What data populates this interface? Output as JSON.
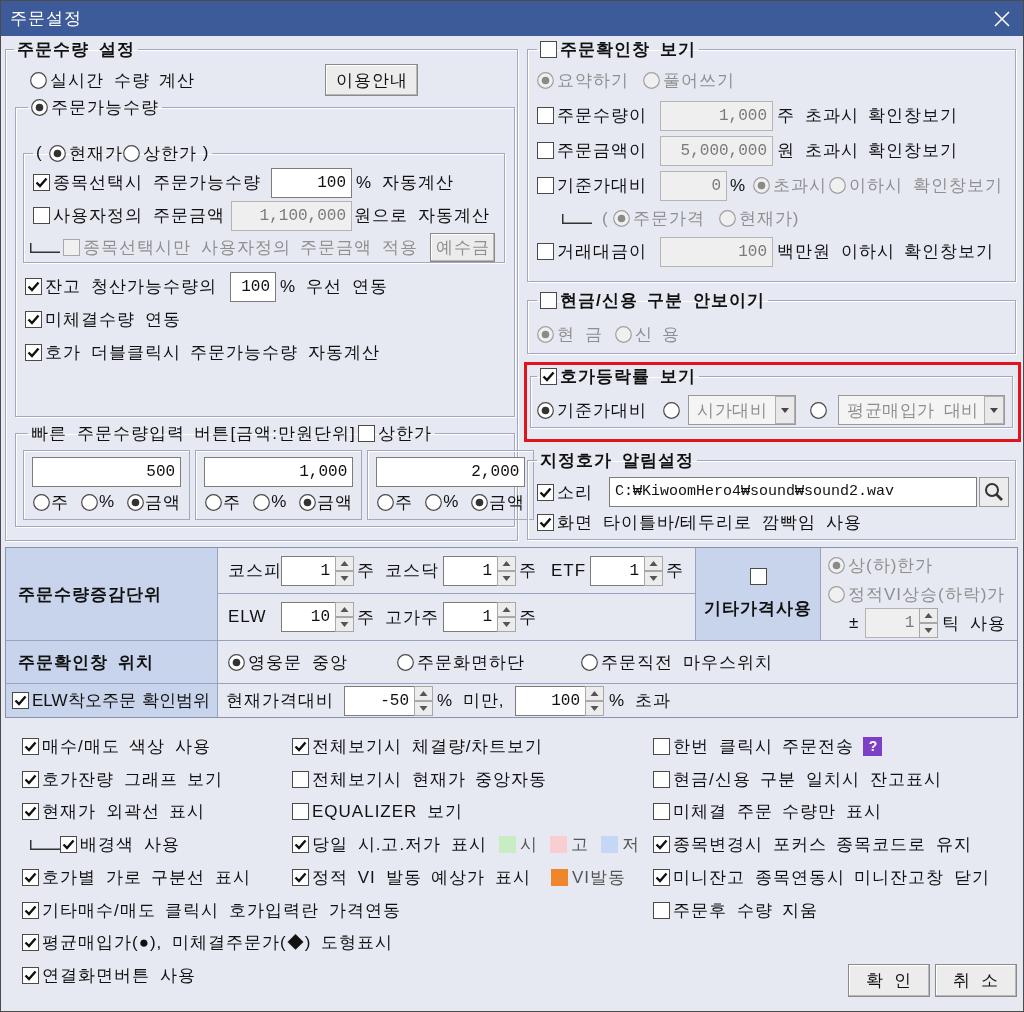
{
  "window": {
    "title": "주문설정"
  },
  "order_qty": {
    "legend": [
      {
        "kind": "text",
        "text": "주문수량 설정"
      }
    ],
    "items": [
      {
        "kind": "row",
        "parts": [
          {
            "kind": "radio",
            "label": "실시간 수량 계산",
            "selected": false
          },
          {
            "kind": "button",
            "label": "이용안내"
          }
        ]
      },
      {
        "kind": "group",
        "legend": [
          {
            "kind": "radio",
            "label": "주문가능수량",
            "selected": true
          }
        ],
        "items": [
          {
            "kind": "group",
            "legend": [
              {
                "kind": "text",
                "text": "("
              },
              {
                "kind": "radio",
                "label": "현재가",
                "selected": true
              },
              {
                "kind": "radio",
                "label": "상한가",
                "selected": false
              },
              {
                "kind": "text",
                "text": ")"
              }
            ],
            "items": [
              {
                "kind": "row",
                "parts": [
                  {
                    "kind": "check",
                    "label": "종목선택시 주문가능수량",
                    "checked": true
                  },
                  {
                    "kind": "input",
                    "value": "100"
                  },
                  {
                    "kind": "text",
                    "text": "% 자동계산"
                  }
                ]
              },
              {
                "kind": "row",
                "parts": [
                  {
                    "kind": "check",
                    "label": "사용자정의 주문금액",
                    "checked": false,
                    "disabled": false
                  },
                  {
                    "kind": "input",
                    "value": "1,100,000",
                    "disabled": true
                  },
                  {
                    "kind": "text",
                    "text": "원으로 자동계산",
                    "disabled": false
                  }
                ]
              },
              {
                "kind": "row",
                "parts": [
                  {
                    "kind": "branch"
                  },
                  {
                    "kind": "check",
                    "label": "종목선택시만 사용자정의 주문금액 적용",
                    "checked": false,
                    "disabled": true
                  },
                  {
                    "kind": "button",
                    "label": "예수금",
                    "disabled": true
                  }
                ]
              }
            ]
          },
          {
            "kind": "row",
            "parts": [
              {
                "kind": "check",
                "label": "잔고 청산가능수량의",
                "checked": true
              },
              {
                "kind": "input",
                "value": "100"
              },
              {
                "kind": "text",
                "text": "% 우선 연동"
              }
            ]
          },
          {
            "kind": "row",
            "parts": [
              {
                "kind": "check",
                "label": "미체결수량 연동",
                "checked": true
              }
            ]
          },
          {
            "kind": "row",
            "parts": [
              {
                "kind": "check",
                "label": "호가 더블클릭시 주문가능수량 자동계산",
                "checked": true
              }
            ]
          }
        ]
      },
      {
        "kind": "group",
        "legend": [
          {
            "kind": "text",
            "text": "빠른 주문수량입력 버튼[금액:만원단위]"
          },
          {
            "kind": "check",
            "label": "상한가",
            "checked": false
          }
        ],
        "items": [
          {
            "kind": "panels",
            "panels": [
              {
                "value": "500",
                "options": [
                  {
                    "label": "주",
                    "selected": false
                  },
                  {
                    "label": "%",
                    "selected": false
                  },
                  {
                    "label": "금액",
                    "selected": true
                  }
                ]
              },
              {
                "value": "1,000",
                "options": [
                  {
                    "label": "주",
                    "selected": false
                  },
                  {
                    "label": "%",
                    "selected": false
                  },
                  {
                    "label": "금액",
                    "selected": true
                  }
                ]
              },
              {
                "value": "2,000",
                "options": [
                  {
                    "label": "주",
                    "selected": false
                  },
                  {
                    "label": "%",
                    "selected": false
                  },
                  {
                    "label": "금액",
                    "selected": true
                  }
                ]
              }
            ]
          }
        ]
      }
    ]
  },
  "confirm_window": {
    "legend": [
      {
        "kind": "check",
        "label": "주문확인창 보기",
        "checked": false
      }
    ],
    "items": [
      {
        "kind": "row",
        "parts": [
          {
            "kind": "radio",
            "label": "요약하기",
            "selected": true,
            "disabled": true
          },
          {
            "kind": "radio",
            "label": "풀어쓰기",
            "selected": false,
            "disabled": true
          }
        ]
      },
      {
        "kind": "row",
        "parts": [
          {
            "kind": "check",
            "label": "주문수량이",
            "checked": false,
            "disabled": false
          },
          {
            "kind": "input",
            "value": "1,000",
            "disabled": true
          },
          {
            "kind": "text",
            "text": "주 초과시 확인창보기",
            "disabled": false
          }
        ]
      },
      {
        "kind": "row",
        "parts": [
          {
            "kind": "check",
            "label": "주문금액이",
            "checked": false,
            "disabled": false
          },
          {
            "kind": "input",
            "value": "5,000,000",
            "disabled": true
          },
          {
            "kind": "text",
            "text": "원 초과시 확인창보기",
            "disabled": false
          }
        ]
      },
      {
        "kind": "row",
        "parts": [
          {
            "kind": "check",
            "label": "기준가대비",
            "checked": false,
            "disabled": false
          },
          {
            "kind": "input",
            "value": "0",
            "disabled": true
          },
          {
            "kind": "text",
            "text": "%",
            "disabled": false
          },
          {
            "kind": "radio",
            "label": "초과시",
            "selected": true,
            "disabled": true
          },
          {
            "kind": "radio",
            "label": "이하시",
            "selected": false,
            "disabled": true
          },
          {
            "kind": "text",
            "text": "확인창보기",
            "disabled": true
          }
        ]
      },
      {
        "kind": "row",
        "parts": [
          {
            "kind": "branch"
          },
          {
            "kind": "text",
            "text": "(",
            "disabled": true
          },
          {
            "kind": "radio",
            "label": "주문가격",
            "selected": true,
            "disabled": true
          },
          {
            "kind": "radio",
            "label": "현재가",
            "selected": false,
            "disabled": true
          },
          {
            "kind": "text",
            "text": ")",
            "disabled": true
          }
        ]
      },
      {
        "kind": "row",
        "parts": [
          {
            "kind": "check",
            "label": "거래대금이",
            "checked": false,
            "disabled": false
          },
          {
            "kind": "input",
            "value": "100",
            "disabled": true
          },
          {
            "kind": "text",
            "text": "백만원 이하시 확인창보기",
            "disabled": false
          }
        ]
      }
    ]
  },
  "cash_credit": {
    "legend": [
      {
        "kind": "check",
        "label": "현금/신용 구분 안보이기",
        "checked": false
      }
    ],
    "items": [
      {
        "kind": "row",
        "parts": [
          {
            "kind": "radio",
            "label": "현 금",
            "selected": true,
            "disabled": true
          },
          {
            "kind": "radio",
            "label": "신 용",
            "selected": false,
            "disabled": true
          }
        ]
      }
    ]
  },
  "quote_change_rate": {
    "highlighted": true,
    "legend": [
      {
        "kind": "check",
        "label": "호가등락률 보기",
        "checked": true
      }
    ],
    "items": [
      {
        "kind": "row",
        "parts": [
          {
            "kind": "radio",
            "label": "기준가대비",
            "selected": true,
            "disabled": false
          },
          {
            "kind": "radio",
            "selected": false,
            "disabled": false
          },
          {
            "kind": "combo",
            "value": "시가대비",
            "disabled": true
          },
          {
            "kind": "radio",
            "selected": false,
            "disabled": false
          },
          {
            "kind": "combo",
            "value": "평균매입가 대비",
            "disabled": true
          }
        ]
      }
    ]
  },
  "price_alert": {
    "legend": [
      {
        "kind": "text",
        "text": "지정호가 알림설정"
      }
    ],
    "items": [
      {
        "kind": "row",
        "parts": [
          {
            "kind": "check",
            "label": "소리",
            "checked": true
          },
          {
            "kind": "input",
            "value": "C:₩KiwoomHero4₩sound₩sound2.wav"
          },
          {
            "kind": "search"
          }
        ]
      },
      {
        "kind": "row",
        "parts": [
          {
            "kind": "check",
            "label": "화면 타이틀바/테두리로 깜빡임 사용",
            "checked": true
          }
        ]
      }
    ]
  },
  "settings_table": {
    "qty_step": {
      "header": [
        {
          "kind": "text",
          "text": "주문수량증감단위"
        }
      ],
      "lines": [
        {
          "parts": [
            {
              "kind": "text",
              "text": "코스피"
            },
            {
              "kind": "spin",
              "value": "1"
            },
            {
              "kind": "text",
              "text": "주"
            },
            {
              "kind": "text",
              "text": "코스닥"
            },
            {
              "kind": "spin",
              "value": "1"
            },
            {
              "kind": "text",
              "text": "주"
            },
            {
              "kind": "text",
              "text": "ETF"
            },
            {
              "kind": "spin",
              "value": "1"
            },
            {
              "kind": "text",
              "text": "주"
            }
          ]
        },
        {
          "parts": [
            {
              "kind": "text",
              "text": "ELW"
            },
            {
              "kind": "spin",
              "value": "10"
            },
            {
              "kind": "text",
              "text": "주"
            },
            {
              "kind": "text",
              "text": "고가주"
            },
            {
              "kind": "spin",
              "value": "1"
            },
            {
              "kind": "text",
              "text": "주"
            }
          ]
        }
      ]
    },
    "other_price": {
      "header": [
        {
          "kind": "check",
          "checked": false
        },
        {
          "kind": "text",
          "text": "기타가격사용"
        }
      ],
      "lines": [
        {
          "parts": [
            {
              "kind": "radio",
              "label": "상(하)한가",
              "selected": true,
              "disabled": true
            }
          ]
        },
        {
          "parts": [
            {
              "kind": "radio",
              "label": "정적VI상승(하락)가",
              "selected": false,
              "disabled": true
            }
          ]
        },
        {
          "parts": [
            {
              "kind": "text",
              "text": "±",
              "disabled": false
            },
            {
              "kind": "spin",
              "value": "1",
              "disabled": true
            },
            {
              "kind": "text",
              "text": "틱 사용",
              "disabled": false
            }
          ]
        }
      ]
    },
    "confirm_position": {
      "header": [
        {
          "kind": "text",
          "text": "주문확인창 위치"
        }
      ],
      "lines": [
        {
          "parts": [
            {
              "kind": "radio",
              "label": "영웅문 중앙",
              "selected": true
            },
            {
              "kind": "radio",
              "label": "주문화면하단",
              "selected": false
            },
            {
              "kind": "radio",
              "label": "주문직전 마우스위치",
              "selected": false
            }
          ]
        }
      ]
    },
    "elw_range": {
      "header": [
        {
          "kind": "check",
          "label": "ELW착오주문 확인범위",
          "checked": true
        }
      ],
      "lines": [
        {
          "parts": [
            {
              "kind": "text",
              "text": "현재가격대비"
            },
            {
              "kind": "spin",
              "value": "-50"
            },
            {
              "kind": "text",
              "text": "% 미만,"
            },
            {
              "kind": "spin",
              "value": "100"
            },
            {
              "kind": "text",
              "text": "% 초과"
            }
          ]
        }
      ]
    }
  },
  "options": {
    "columns": [
      {
        "rows": [
          {
            "parts": [
              {
                "kind": "check",
                "label": "매수/매도 색상 사용",
                "checked": true
              }
            ]
          },
          {
            "parts": [
              {
                "kind": "check",
                "label": "호가잔량 그래프 보기",
                "checked": true
              }
            ]
          },
          {
            "parts": [
              {
                "kind": "check",
                "label": "현재가 외곽선 표시",
                "checked": true
              }
            ]
          },
          {
            "parts": [
              {
                "kind": "branch"
              },
              {
                "kind": "check",
                "label": "배경색 사용",
                "checked": true
              }
            ]
          },
          {
            "parts": [
              {
                "kind": "check",
                "label": "호가별 가로 구분선 표시",
                "checked": true
              }
            ]
          },
          {
            "parts": [
              {
                "kind": "check",
                "label": "기타매수/매도 클릭시 호가입력란 가격연동",
                "checked": true
              }
            ]
          },
          {
            "parts": [
              {
                "kind": "check",
                "label": "평균매입가(●), 미체결주문가(◆) 도형표시",
                "checked": true
              }
            ]
          },
          {
            "parts": [
              {
                "kind": "check",
                "label": "연결화면버튼 사용",
                "checked": true
              }
            ]
          }
        ]
      },
      {
        "rows": [
          {
            "parts": [
              {
                "kind": "check",
                "label": "전체보기시 체결량/차트보기",
                "checked": true
              }
            ]
          },
          {
            "parts": [
              {
                "kind": "check",
                "label": "전체보기시 현재가 중앙자동",
                "checked": false
              }
            ]
          },
          {
            "parts": [
              {
                "kind": "check",
                "label": "EQUALIZER 보기",
                "checked": false
              }
            ]
          },
          {
            "parts": [
              {
                "kind": "check",
                "label": "당일 시.고.저가 표시",
                "checked": true
              },
              {
                "kind": "swatch",
                "color": "#c8edc2"
              },
              {
                "kind": "text",
                "text": "시"
              },
              {
                "kind": "swatch",
                "color": "#f8ced0"
              },
              {
                "kind": "text",
                "text": "고"
              },
              {
                "kind": "swatch",
                "color": "#c6d7f6"
              },
              {
                "kind": "text",
                "text": "저"
              }
            ]
          },
          {
            "parts": [
              {
                "kind": "check",
                "label": "정적 VI 발동 예상가 표시",
                "checked": true
              },
              {
                "kind": "swatch",
                "color": "#f0862c"
              },
              {
                "kind": "text",
                "text": "VI발동"
              }
            ]
          }
        ]
      },
      {
        "rows": [
          {
            "parts": [
              {
                "kind": "check",
                "label": "한번 클릭시 주문전송",
                "checked": false
              },
              {
                "kind": "help",
                "text": "?"
              }
            ]
          },
          {
            "parts": [
              {
                "kind": "check",
                "label": "현금/신용 구분 일치시 잔고표시",
                "checked": false
              }
            ]
          },
          {
            "parts": [
              {
                "kind": "check",
                "label": "미체결 주문 수량만 표시",
                "checked": false
              }
            ]
          },
          {
            "parts": [
              {
                "kind": "check",
                "label": "종목변경시 포커스 종목코드로 유지",
                "checked": true
              }
            ]
          },
          {
            "parts": [
              {
                "kind": "check",
                "label": "미니잔고 종목연동시 미니잔고창 닫기",
                "checked": true
              }
            ]
          },
          {
            "parts": [
              {
                "kind": "check",
                "label": "주문후 수량 지움",
                "checked": false
              }
            ]
          }
        ]
      }
    ]
  },
  "buttons": [
    "확 인",
    "취 소"
  ]
}
